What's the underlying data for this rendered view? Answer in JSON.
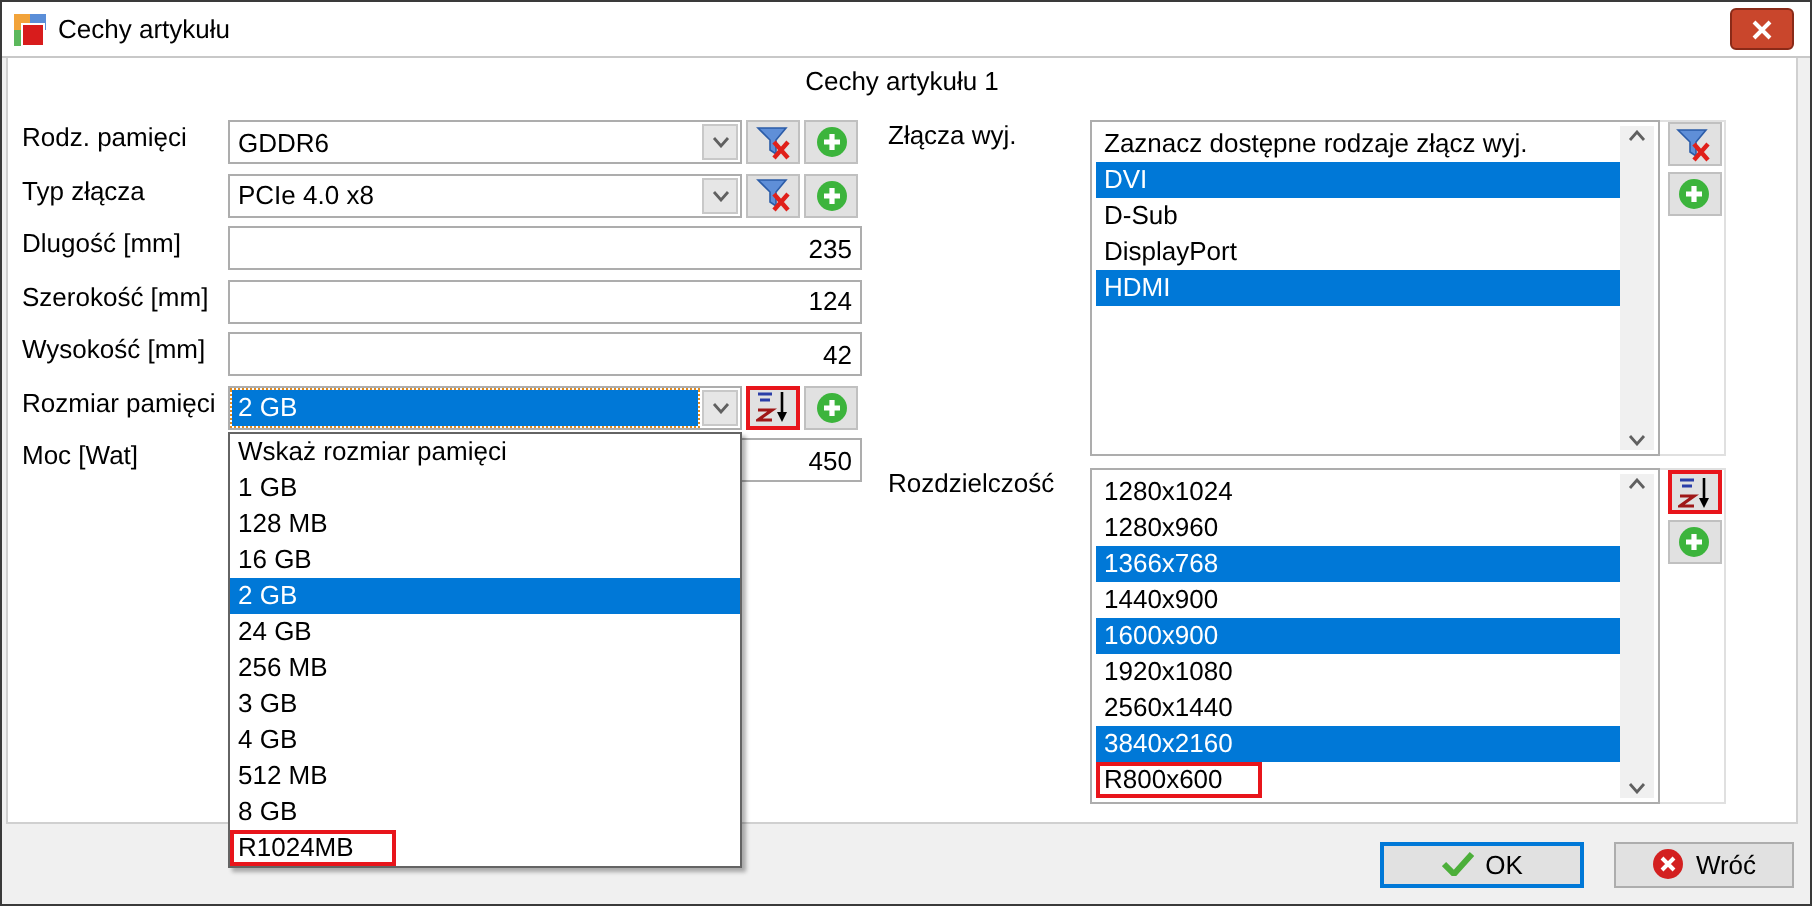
{
  "window": {
    "title": "Cechy artykułu"
  },
  "heading": "Cechy artykułu 1",
  "fields": [
    {
      "kind": "combo",
      "label": "Rodz. pamięci",
      "value": "GDDR6",
      "focused": false,
      "tools": [
        {
          "kind": "filter",
          "highlighted": false
        },
        {
          "kind": "add",
          "highlighted": false
        }
      ]
    },
    {
      "kind": "combo",
      "label": "Typ złącza",
      "value": "PCIe 4.0 x8",
      "focused": false,
      "tools": [
        {
          "kind": "filter",
          "highlighted": false
        },
        {
          "kind": "add",
          "highlighted": false
        }
      ]
    },
    {
      "kind": "number",
      "label": "Dlugość [mm]",
      "value": "235"
    },
    {
      "kind": "number",
      "label": "Szerokość [mm]",
      "value": "124"
    },
    {
      "kind": "number",
      "label": "Wysokość [mm]",
      "value": "42"
    },
    {
      "kind": "combo",
      "label": "Rozmiar pamięci",
      "value": "2 GB",
      "focused": true,
      "tools": [
        {
          "kind": "sort",
          "highlighted": true
        },
        {
          "kind": "add",
          "highlighted": false
        }
      ],
      "dropdown": [
        {
          "label": "Wskaż rozmiar pamięci",
          "selected": false,
          "highlighted": false
        },
        {
          "label": "1 GB",
          "selected": false,
          "highlighted": false
        },
        {
          "label": "128 MB",
          "selected": false,
          "highlighted": false
        },
        {
          "label": "16 GB",
          "selected": false,
          "highlighted": false
        },
        {
          "label": "2 GB",
          "selected": true,
          "highlighted": false
        },
        {
          "label": "24 GB",
          "selected": false,
          "highlighted": false
        },
        {
          "label": "256 MB",
          "selected": false,
          "highlighted": false
        },
        {
          "label": "3 GB",
          "selected": false,
          "highlighted": false
        },
        {
          "label": "4 GB",
          "selected": false,
          "highlighted": false
        },
        {
          "label": "512 MB",
          "selected": false,
          "highlighted": false
        },
        {
          "label": "8 GB",
          "selected": false,
          "highlighted": false
        },
        {
          "label": "R1024MB",
          "selected": false,
          "highlighted": true
        }
      ]
    },
    {
      "kind": "number",
      "label": "Moc [Wat]",
      "value": "450"
    }
  ],
  "lists": [
    {
      "label": "Złącza wyj.",
      "tools": [
        {
          "kind": "filter",
          "highlighted": false
        },
        {
          "kind": "add",
          "highlighted": false
        }
      ],
      "items": [
        {
          "label": "Zaznacz dostępne rodzaje złącz wyj.",
          "selected": false,
          "highlighted": false
        },
        {
          "label": "DVI",
          "selected": true,
          "highlighted": false
        },
        {
          "label": "D-Sub",
          "selected": false,
          "highlighted": false
        },
        {
          "label": "DisplayPort",
          "selected": false,
          "highlighted": false
        },
        {
          "label": "HDMI",
          "selected": true,
          "highlighted": false
        }
      ]
    },
    {
      "label": "Rozdzielczość",
      "tools": [
        {
          "kind": "sort",
          "highlighted": true
        },
        {
          "kind": "add",
          "highlighted": false
        }
      ],
      "items": [
        {
          "label": "1280x1024",
          "selected": false,
          "highlighted": false
        },
        {
          "label": "1280x960",
          "selected": false,
          "highlighted": false
        },
        {
          "label": "1366x768",
          "selected": true,
          "highlighted": false
        },
        {
          "label": "1440x900",
          "selected": false,
          "highlighted": false
        },
        {
          "label": "1600x900",
          "selected": true,
          "highlighted": false
        },
        {
          "label": "1920x1080",
          "selected": false,
          "highlighted": false
        },
        {
          "label": "2560x1440",
          "selected": false,
          "highlighted": false
        },
        {
          "label": "3840x2160",
          "selected": true,
          "highlighted": false
        },
        {
          "label": "R800x600",
          "selected": false,
          "highlighted": true
        }
      ]
    }
  ],
  "buttons": [
    {
      "kind": "ok",
      "label": "OK",
      "default": true
    },
    {
      "kind": "cancel",
      "label": "Wróć",
      "default": false
    }
  ]
}
